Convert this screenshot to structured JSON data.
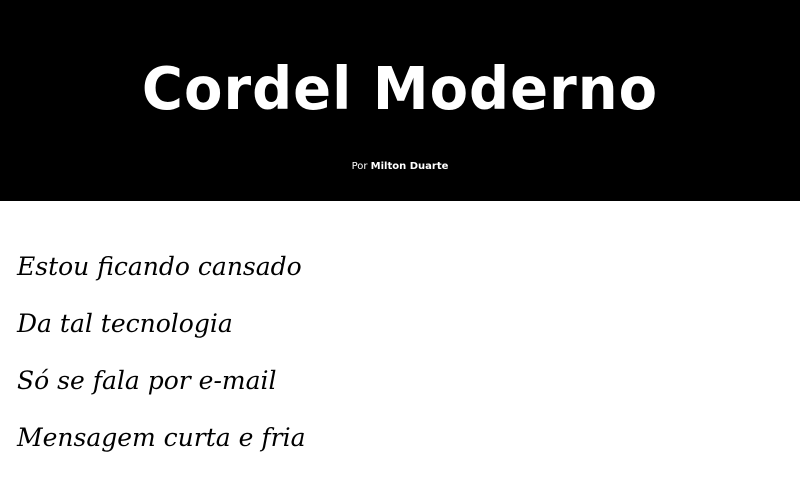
{
  "header": {
    "title": "Cordel Moderno",
    "byline_prefix": "Por",
    "author": "Milton Duarte",
    "background_color": "#000000",
    "text_color": "#ffffff"
  },
  "poem": {
    "lines": [
      "Estou ficando cansado",
      "Da tal tecnologia",
      "Só se fala por e-mail",
      "Mensagem curta e fria"
    ]
  }
}
